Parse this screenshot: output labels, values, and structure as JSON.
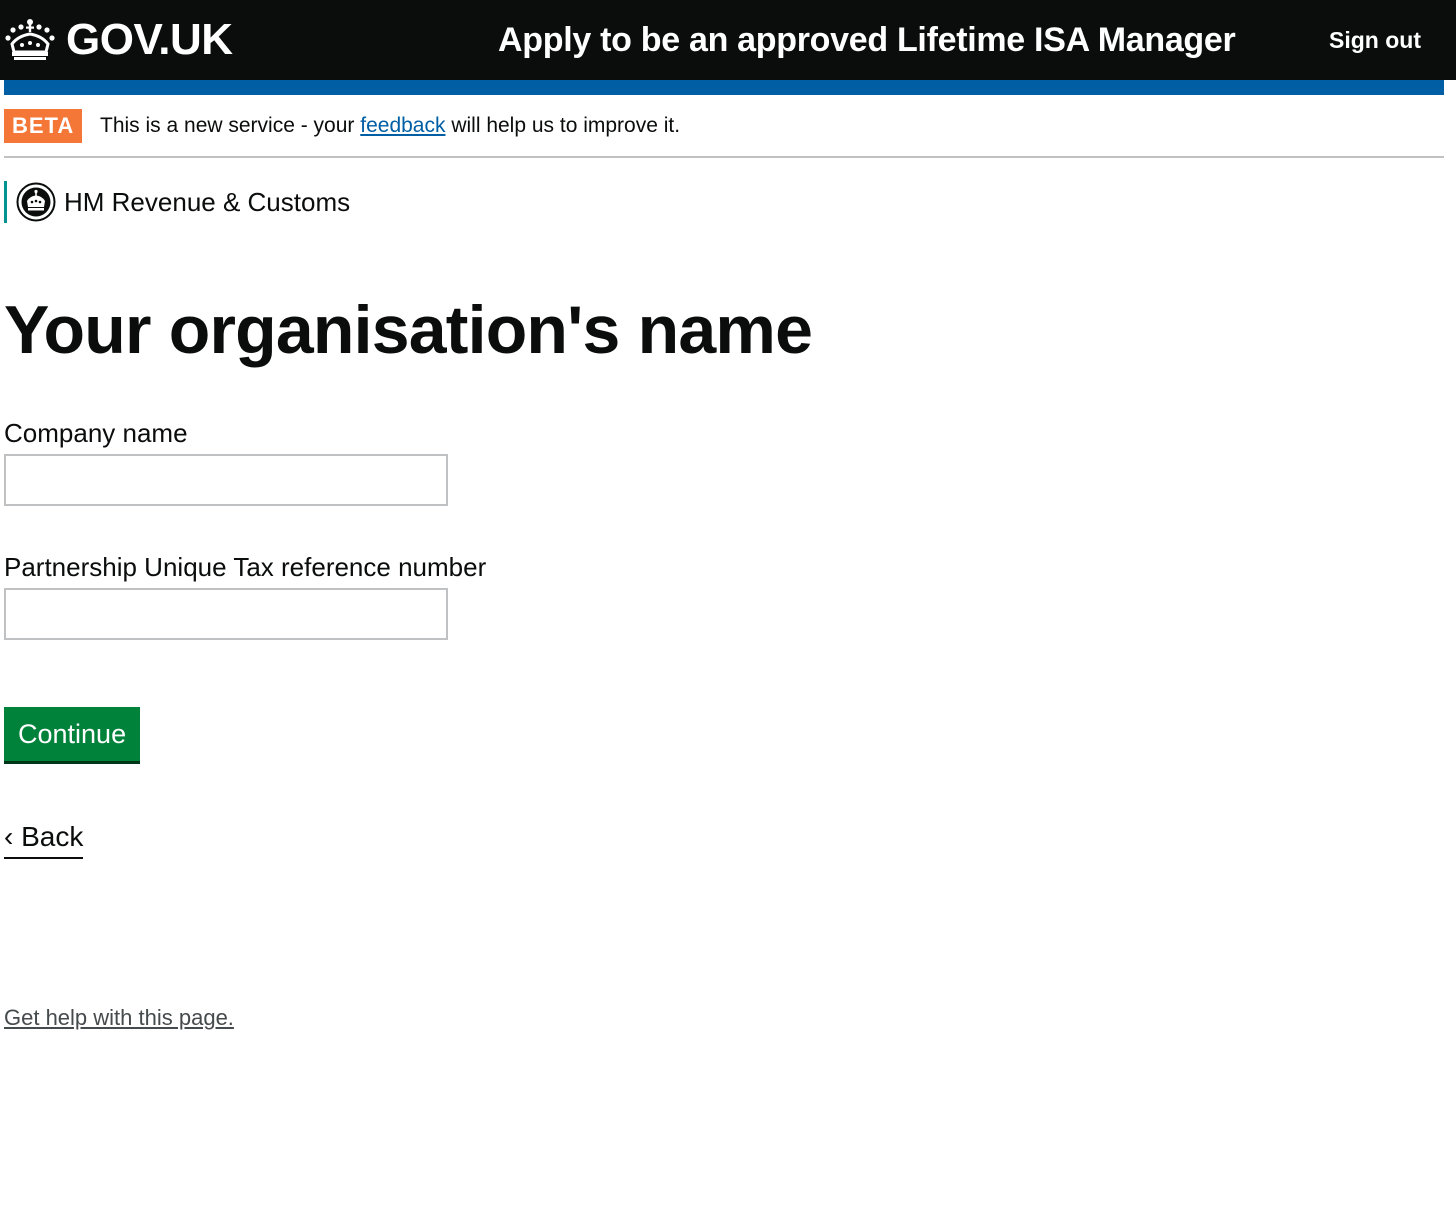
{
  "header": {
    "logo_text": "GOV.UK",
    "logo_icon": "crown-icon",
    "service_name": "Apply to be an approved Lifetime ISA Manager",
    "sign_out_label": "Sign out"
  },
  "phase_banner": {
    "tag": "BETA",
    "text_before": "This is a new service - your ",
    "link_text": "feedback",
    "text_after": " will help us to improve it."
  },
  "organisation": {
    "name": "HM Revenue & Customs",
    "icon": "crest-icon"
  },
  "main": {
    "title": "Your organisation's name",
    "fields": [
      {
        "label": "Company name",
        "value": "",
        "placeholder": ""
      },
      {
        "label": "Partnership Unique Tax reference number",
        "value": "",
        "placeholder": ""
      }
    ],
    "continue_label": "Continue",
    "back_label": "‹ Back"
  },
  "footer": {
    "help_link": "Get help with this page."
  },
  "colors": {
    "header_bg": "#0b0c0c",
    "header_bar": "#005ea5",
    "beta_tag": "#f47738",
    "link": "#005ea5",
    "org_border": "#009390",
    "button": "#00823b"
  }
}
